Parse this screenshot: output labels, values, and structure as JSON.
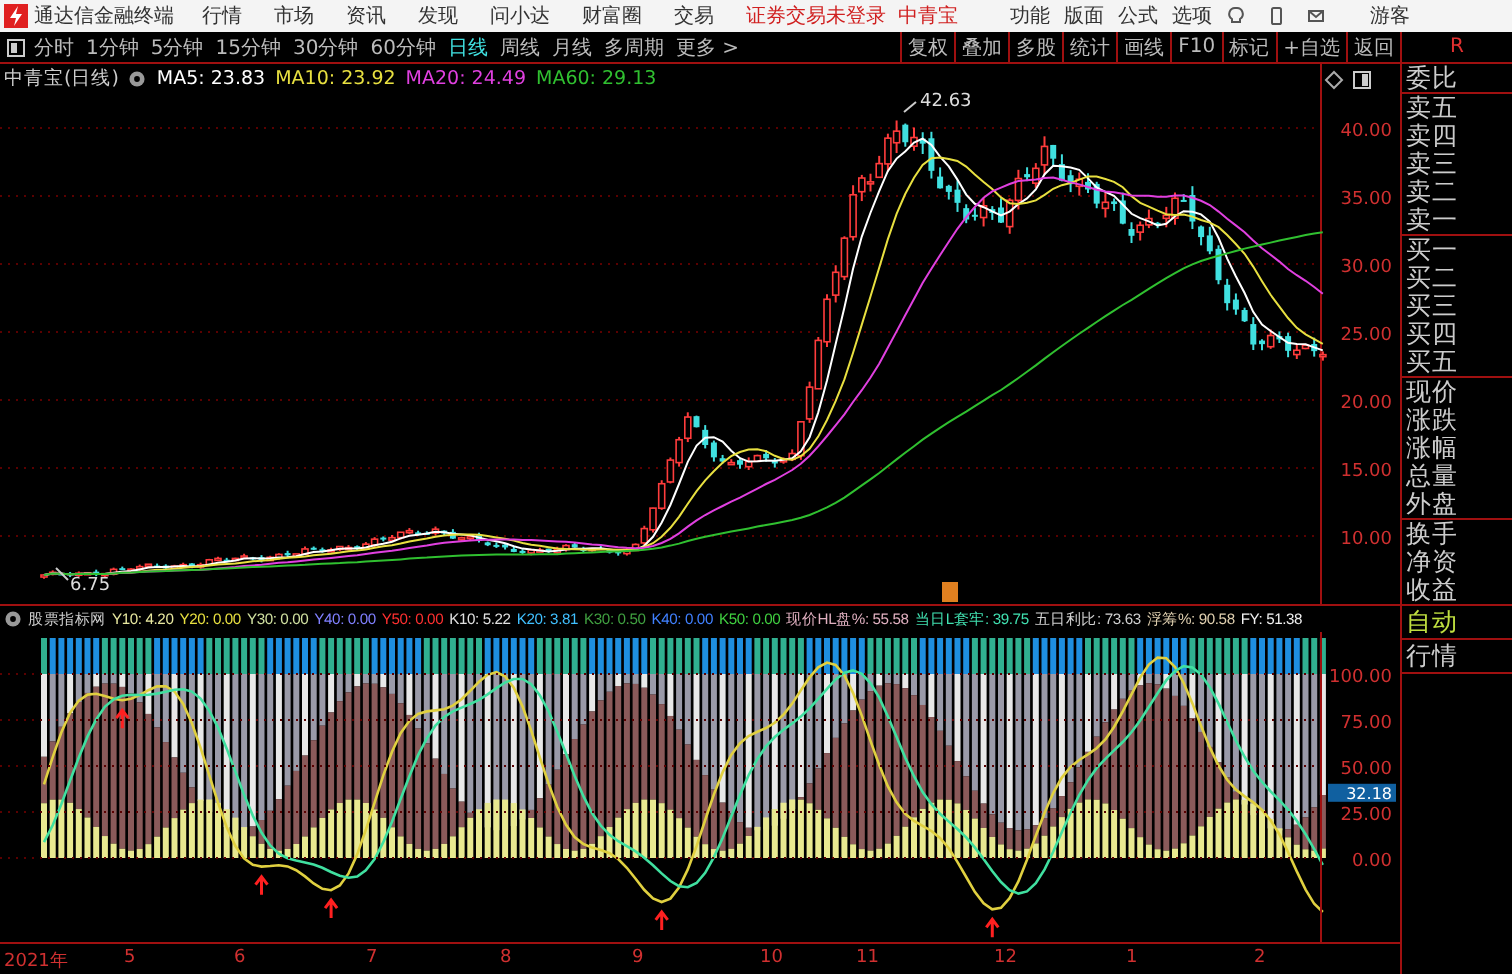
{
  "app_bar": {
    "app_name": "通达信金融终端",
    "menu": [
      "行情",
      "市场",
      "资讯",
      "发现",
      "问小达",
      "财富圈",
      "交易"
    ],
    "login_notice": "证券交易未登录",
    "stock_name": "中青宝",
    "tools": [
      "功能",
      "版面",
      "公式",
      "选项"
    ],
    "user": "游客"
  },
  "toolbar": {
    "periods": [
      {
        "label": "分时",
        "selected": false
      },
      {
        "label": "1分钟",
        "selected": false
      },
      {
        "label": "5分钟",
        "selected": false
      },
      {
        "label": "15分钟",
        "selected": false
      },
      {
        "label": "30分钟",
        "selected": false
      },
      {
        "label": "60分钟",
        "selected": false
      },
      {
        "label": "日线",
        "selected": true
      },
      {
        "label": "周线",
        "selected": false
      },
      {
        "label": "月线",
        "selected": false
      },
      {
        "label": "多周期",
        "selected": false
      },
      {
        "label": "更多 >",
        "selected": false
      }
    ],
    "actions": [
      "复权",
      "叠加",
      "多股",
      "统计",
      "画线",
      "F10",
      "标记",
      "+自选",
      "返回"
    ],
    "panel_tab": "R"
  },
  "main_chart": {
    "title": "中青宝(日线)",
    "indicators": [
      {
        "label": "MA5: 23.83",
        "color": "#ffffff"
      },
      {
        "label": "MA10: 23.92",
        "color": "#e8e040"
      },
      {
        "label": "MA20: 24.49",
        "color": "#e040e0"
      },
      {
        "label": "MA60: 29.13",
        "color": "#30c030"
      }
    ],
    "high_label": "42.63",
    "low_label": "6.75",
    "y_labels": [
      "40.00",
      "35.00",
      "30.00",
      "25.00",
      "20.00",
      "15.00",
      "10.00"
    ]
  },
  "indicator_panel": {
    "title": "股票指标网",
    "values": [
      {
        "label": "Y10: 4.20",
        "color": "#e8e8a0"
      },
      {
        "label": "Y20: 0.00",
        "color": "#e8e040"
      },
      {
        "label": "Y30: 0.00",
        "color": "#d0e0a0"
      },
      {
        "label": "Y40: 0.00",
        "color": "#8080ff"
      },
      {
        "label": "Y50: 0.00",
        "color": "#ff3030"
      },
      {
        "label": "K10: 5.22",
        "color": "#e0e0e0"
      },
      {
        "label": "K20: 3.81",
        "color": "#40c0ff"
      },
      {
        "label": "K30: 0.50",
        "color": "#40a040"
      },
      {
        "label": "K40: 0.00",
        "color": "#4080ff"
      },
      {
        "label": "K50: 0.00",
        "color": "#40d040"
      },
      {
        "label": "现价HL盘%: 55.58",
        "color": "#e0b0c0"
      },
      {
        "label": "当日L套牢: 39.75",
        "color": "#40e0b0"
      },
      {
        "label": "五日利比: 73.63",
        "color": "#d0d0d0"
      },
      {
        "label": "浮筹%: 90.58",
        "color": "#e0d0b0"
      },
      {
        "label": "FY: 51.38",
        "color": "#f0f0f0"
      }
    ],
    "y_labels": [
      "100.00",
      "75.00",
      "50.00",
      "25.00",
      "0.00"
    ],
    "current_value": "32.18"
  },
  "x_axis": [
    "2021年",
    "5",
    "6",
    "7",
    "8",
    "9",
    "10",
    "11",
    "12",
    "1",
    "2"
  ],
  "quote_sidebar": {
    "groups": [
      [
        "委比"
      ],
      [
        "卖五",
        "卖四",
        "卖三",
        "卖二",
        "卖一"
      ],
      [
        "买一",
        "买二",
        "买三",
        "买四",
        "买五"
      ],
      [
        "现价",
        "涨跌",
        "涨幅",
        "总量",
        "外盘"
      ],
      [
        "换手",
        "净资",
        "收益"
      ]
    ],
    "buttons": [
      {
        "label": "自动",
        "selected": true
      },
      {
        "label": "行情",
        "selected": false
      }
    ]
  }
}
